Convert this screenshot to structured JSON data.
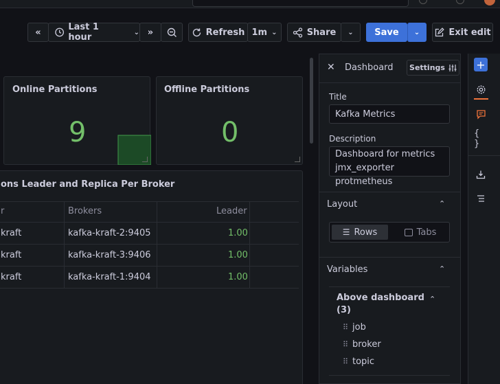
{
  "toolbar": {
    "time_range": "Last 1 hour",
    "refresh": "Refresh",
    "interval": "1m",
    "share": "Share",
    "save": "Save",
    "exit_edit": "Exit edit"
  },
  "panels": {
    "online": {
      "title": "Online Partitions",
      "value": "9"
    },
    "offline": {
      "title": "Offline Partitions",
      "value": "0"
    },
    "table": {
      "title": "ons Leader and Replica Per Broker",
      "headers": [
        "r",
        "Brokers",
        "Leader"
      ],
      "rows": [
        [
          "kraft",
          "kafka-kraft-2:9405",
          "1.00"
        ],
        [
          "kraft",
          "kafka-kraft-3:9406",
          "1.00"
        ],
        [
          "kraft",
          "kafka-kraft-1:9404",
          "1.00"
        ]
      ]
    }
  },
  "sidepane": {
    "title": "Dashboard",
    "settings": "Settings",
    "title_label": "Title",
    "title_value": "Kafka Metrics",
    "description_label": "Description",
    "description_line1": "Dashboard for metrics",
    "description_line2": "jmx_exporter protmetheus",
    "layout": "Layout",
    "rows": "Rows",
    "tabs": "Tabs",
    "variables": "Variables",
    "above_dashboard": "Above dashboard",
    "count": "(3)",
    "vars": [
      "job",
      "broker",
      "topic"
    ]
  },
  "colors": {
    "accent": "#3d71d9",
    "value": "#73bf69",
    "comment": "#f2743b"
  }
}
